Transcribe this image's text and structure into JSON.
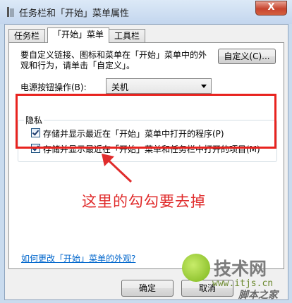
{
  "window": {
    "title": "任务栏和「开始」菜单属性",
    "close_glyph": "X"
  },
  "tabs": [
    {
      "label": "任务栏",
      "active": false
    },
    {
      "label": "「开始」菜单",
      "active": true
    },
    {
      "label": "工具栏",
      "active": false
    }
  ],
  "start_menu": {
    "description": "要自定义链接、图标和菜单在「开始」菜单中的外观和行为，请单击「自定义」。",
    "customize_label": "自定义(C)...",
    "power_label": "电源按钮操作(B):",
    "power_value": "关机",
    "privacy": {
      "title": "隐私",
      "items": [
        {
          "label": "存储并显示最近在「开始」菜单中打开的程序(P)",
          "checked": true
        },
        {
          "label": "存储并显示最近在「开始」菜单和任务栏中打开的项目(M)",
          "checked": true
        }
      ]
    },
    "help_link": "如何更改「开始」菜单的外观?"
  },
  "annotation": {
    "text": "这里的勾勾要去掉",
    "color": "#e02c2c"
  },
  "buttons": {
    "ok": "确定",
    "cancel": "取消"
  },
  "watermark": {
    "brand": "技术网",
    "site": "www.itjs.cn",
    "site2": "脚本之家"
  },
  "colors": {
    "highlight_box": "#e8231f",
    "link": "#0066cc"
  }
}
